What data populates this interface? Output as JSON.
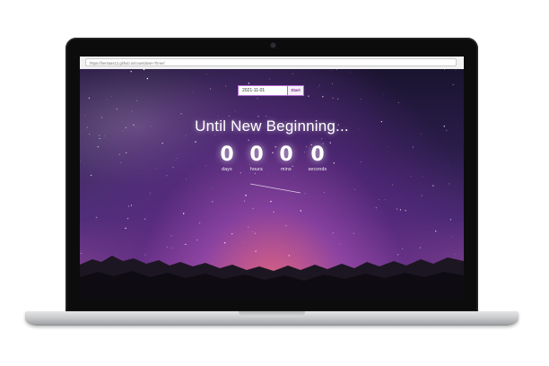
{
  "browser": {
    "url": "https://bentaas12.github.io/countdown-Timer/"
  },
  "countdown": {
    "date_value": "2021-11-01",
    "start_label": "Start",
    "title": "Until New Beginning...",
    "units": [
      {
        "value": "0",
        "label": "days"
      },
      {
        "value": "0",
        "label": "hours"
      },
      {
        "value": "0",
        "label": "mins"
      },
      {
        "value": "0",
        "label": "seconds"
      }
    ]
  },
  "colors": {
    "accent": "#b06ad1",
    "text": "#ffffff",
    "sky_top": "#1a1430",
    "horizon": "#f08a5d"
  }
}
